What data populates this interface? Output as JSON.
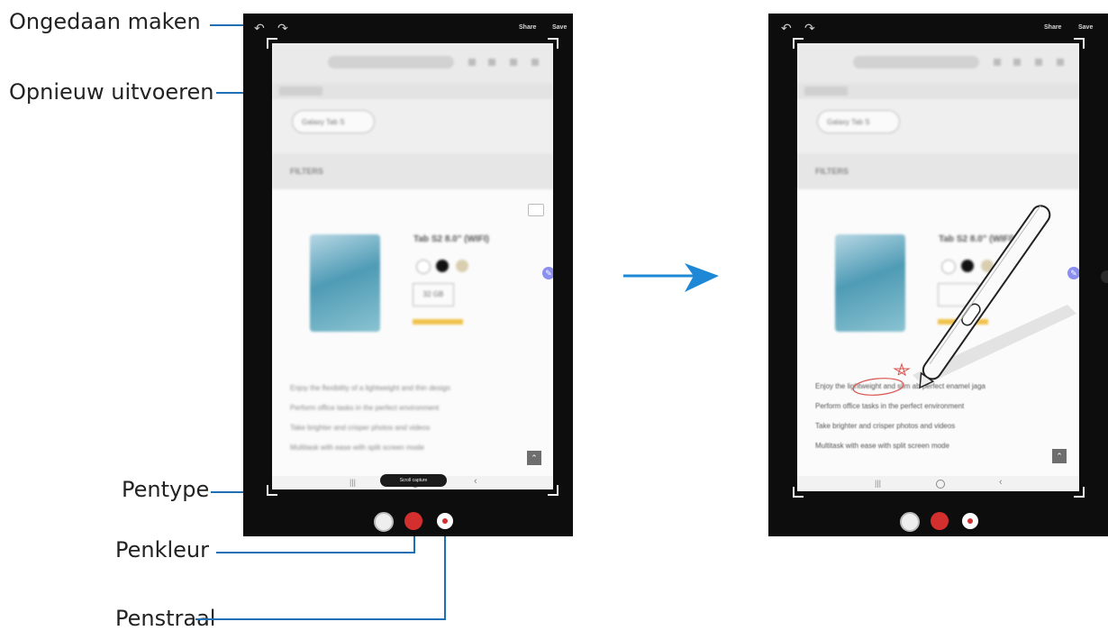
{
  "callouts": {
    "undo": "Ongedaan maken",
    "redo": "Opnieuw uitvoeren",
    "pen_type": "Pentype",
    "pen_color": "Penkleur",
    "pen_stroke": "Penstraal"
  },
  "left_screen": {
    "top_actions": {
      "share": "Share",
      "save": "Save"
    },
    "search_chip": "Galaxy Tab S",
    "filters_label": "FILTERS",
    "product_title": "Tab S2 8.0\" (WIFI)",
    "storage_option": "32 GB",
    "features": [
      "Enjoy the flexibility of a lightweight and thin design",
      "Perform office tasks in the perfect environment",
      "Take brighter and crisper photos and videos",
      "Multitask with ease with split screen mode"
    ],
    "toast": "Scroll capture"
  },
  "right_screen": {
    "top_actions": {
      "share": "Share",
      "save": "Save"
    },
    "search_chip": "Galaxy Tab S",
    "filters_label": "FILTERS",
    "product_title": "Tab S2 8.0\" (WIFI)",
    "features": [
      "Enjoy the lightweight and slim ab perfect enamel jaga",
      "Perform office tasks in the perfect environment",
      "Take brighter and crisper photos and videos",
      "Multitask with ease with split screen mode"
    ]
  },
  "colors": {
    "leader": "#1f6fb5",
    "arrow": "#1e88d6",
    "pen_red": "#d32f2f",
    "tablet": "#0d0d0d"
  }
}
